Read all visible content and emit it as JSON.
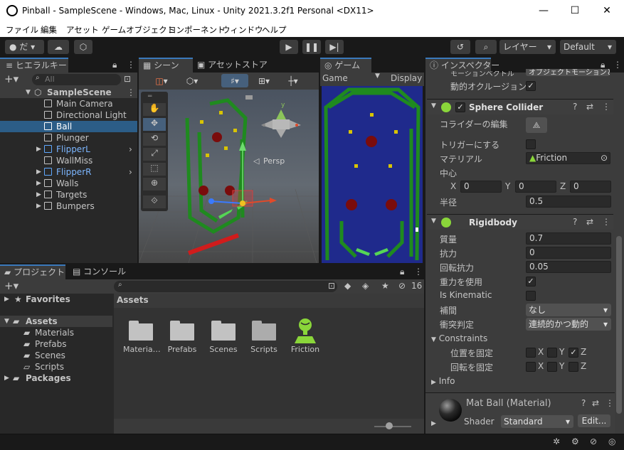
{
  "window": {
    "title": "Pinball - SampleScene - Windows, Mac, Linux - Unity 2021.3.2f1 Personal <DX11>",
    "min": "—",
    "max": "☐",
    "close": "✕"
  },
  "menu": [
    "ファイル",
    "編集",
    "アセット",
    "ゲームオブジェクト",
    "コンポーネント",
    "ウィンドウ",
    "ヘルプ"
  ],
  "toolbar": {
    "account": "だ",
    "layers": "レイヤー",
    "layout": "Default"
  },
  "hierarchy": {
    "tab": "ヒエラルキー",
    "search_placeholder": "All",
    "scene": "SampleScene",
    "items": [
      {
        "label": "Main Camera"
      },
      {
        "label": "Directional Light"
      },
      {
        "label": "Ball"
      },
      {
        "label": "Plunger"
      },
      {
        "label": "FlipperL"
      },
      {
        "label": "WallMiss"
      },
      {
        "label": "FlipperR"
      },
      {
        "label": "Walls"
      },
      {
        "label": "Targets"
      },
      {
        "label": "Bumpers"
      }
    ]
  },
  "scene_view": {
    "tab_scene": "シーン",
    "tab_asset_store": "アセットストア",
    "persp": "Persp",
    "gizmo_y": "y"
  },
  "game_view": {
    "tab": "ゲーム",
    "mode": "Game",
    "display": "Display"
  },
  "project": {
    "tab_project": "プロジェクト",
    "tab_console": "コンソール",
    "favorites": "Favorites",
    "assets": "Assets",
    "folders": [
      "Materials",
      "Prefabs",
      "Scenes",
      "Scripts"
    ],
    "packages": "Packages",
    "breadcrumb": "Assets",
    "hidden_count": "16",
    "grid": [
      {
        "label": "Materia…"
      },
      {
        "label": "Prefabs"
      },
      {
        "label": "Scenes"
      },
      {
        "label": "Scripts"
      },
      {
        "label": "Friction"
      }
    ]
  },
  "inspector": {
    "tab": "インスペクター",
    "partial_top": "モーションベクトル",
    "partial_top_value": "オブジェクトモーションと",
    "dynamic_occlusion": "動的オクルージョン",
    "sphere_collider": {
      "title": "Sphere Collider",
      "edit_collider": "コライダーの編集",
      "is_trigger": "トリガーにする",
      "material_label": "マテリアル",
      "material_value": "Friction",
      "center_label": "中心",
      "x": "0",
      "y": "0",
      "z": "0",
      "radius_label": "半径",
      "radius": "0.5"
    },
    "rigidbody": {
      "title": "Rigidbody",
      "mass_label": "質量",
      "mass": "0.7",
      "drag_label": "抗力",
      "drag": "0",
      "angular_drag_label": "回転抗力",
      "angular_drag": "0.05",
      "use_gravity_label": "重力を使用",
      "is_kinematic_label": "Is Kinematic",
      "interpolate_label": "補間",
      "interpolate": "なし",
      "collision_label": "衝突判定",
      "collision": "連続的かつ動的",
      "constraints_label": "Constraints",
      "freeze_pos_label": "位置を固定",
      "freeze_rot_label": "回転を固定",
      "axis_x": "X",
      "axis_y": "Y",
      "axis_z": "Z"
    },
    "info_label": "Info",
    "material": {
      "title": "Mat Ball (Material)",
      "shader_label": "Shader",
      "shader": "Standard",
      "edit": "Edit..."
    }
  },
  "colors": {
    "accent": "#3a79bb",
    "selection": "#2c5d87",
    "game_bg": "#1f2a8c",
    "wall_green": "#1f7a1f",
    "bumper_red": "#6b0d0d"
  }
}
